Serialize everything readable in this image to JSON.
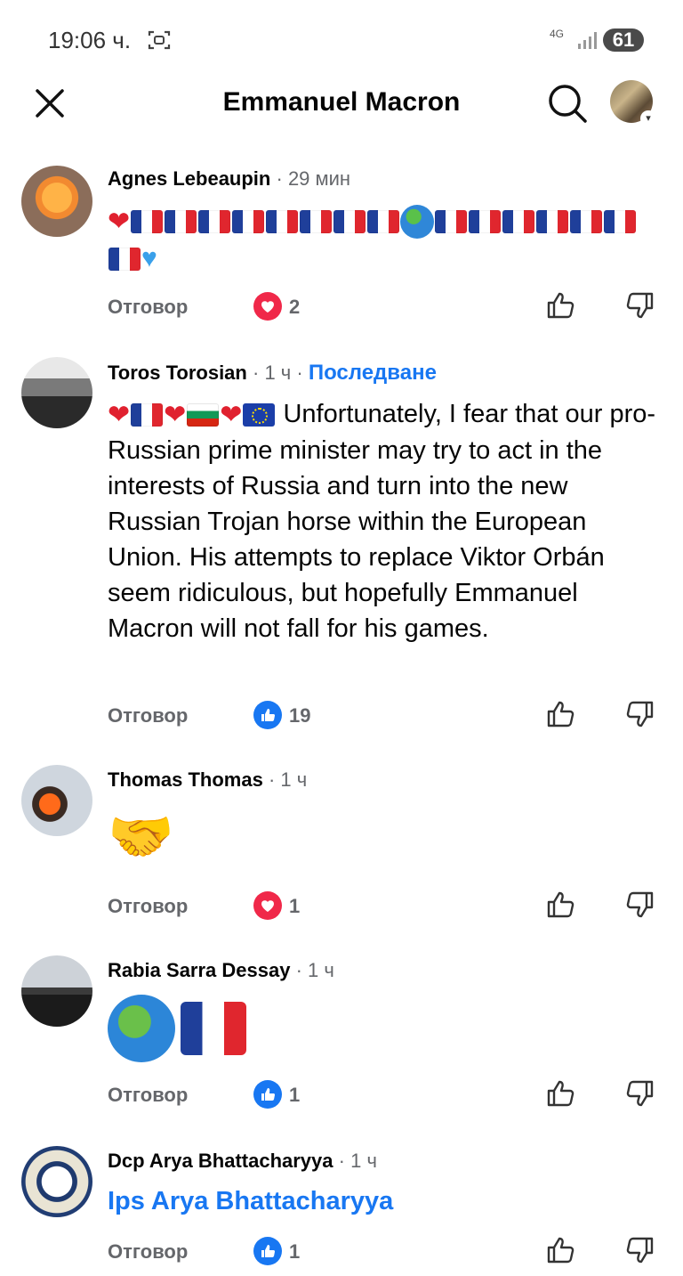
{
  "status": {
    "time": "19:06 ч.",
    "network": "4G",
    "battery": "61"
  },
  "header": {
    "title": "Emmanuel Macron"
  },
  "comments": [
    {
      "author": "Agnes Lebeaupin",
      "time": "29 мин",
      "reply_label": "Отговор",
      "reaction": "heart",
      "reaction_count": "2"
    },
    {
      "author": "Toros Torosian",
      "time": "1 ч",
      "follow_label": "Последване",
      "text": "Unfortunately, I fear that our pro-Russian prime minister may try to act in the interests of Russia and turn into the new Russian Trojan horse within the European Union. His attempts to replace Viktor Orbán seem ridiculous, but hopefully Emmanuel Macron will not fall for his games.",
      "reply_label": "Отговор",
      "reaction": "like",
      "reaction_count": "19"
    },
    {
      "author": "Thomas Thomas",
      "time": "1 ч",
      "reply_label": "Отговор",
      "reaction": "heart",
      "reaction_count": "1"
    },
    {
      "author": "Rabia Sarra Dessay",
      "time": "1 ч",
      "reply_label": "Отговор",
      "reaction": "like",
      "reaction_count": "1"
    },
    {
      "author": "Dcp Arya Bhattacharyya",
      "time": "1 ч",
      "text": "Ips Arya Bhattacharyya",
      "reply_label": "Отговор",
      "reaction": "like",
      "reaction_count": "1"
    }
  ],
  "colors": {
    "accent": "#1877f2",
    "love": "#f02849",
    "muted": "#65676b"
  },
  "icons": [
    "close-icon",
    "search-icon",
    "thumb-up-icon",
    "thumb-down-icon",
    "heart-reaction-icon",
    "like-reaction-icon"
  ]
}
